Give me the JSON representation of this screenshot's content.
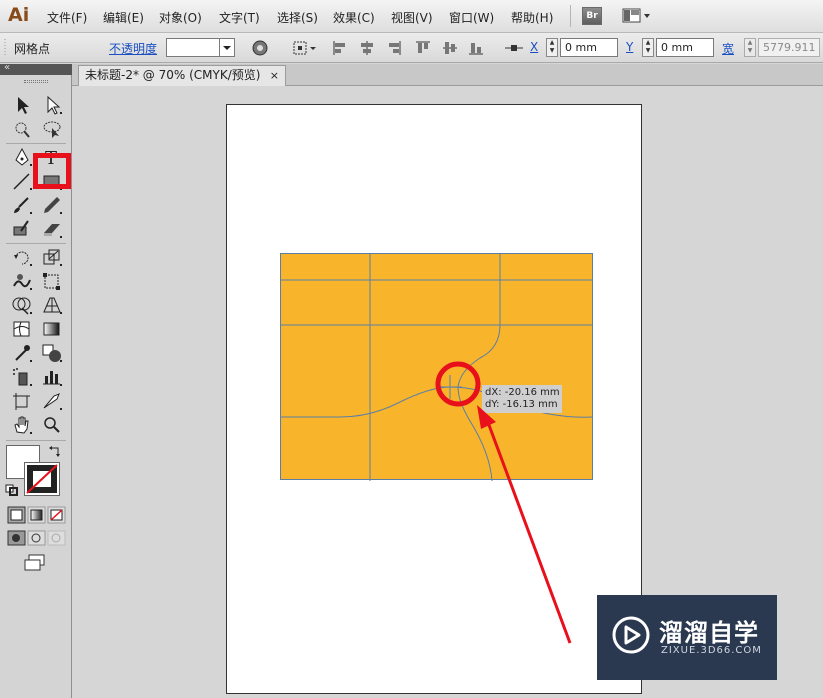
{
  "app": {
    "logo": "Ai"
  },
  "menu": [
    "文件(F)",
    "编辑(E)",
    "对象(O)",
    "文字(T)",
    "选择(S)",
    "效果(C)",
    "视图(V)",
    "窗口(W)",
    "帮助(H)"
  ],
  "menubar_extras": {
    "bridge_label": "Br"
  },
  "control_bar": {
    "selection_label": "网格点",
    "opacity_label": "不透明度",
    "opacity_value": "",
    "x_label": "X",
    "x_value": "0 mm",
    "y_label": "Y",
    "y_value": "0 mm",
    "width_label": "宽",
    "width_value": "5779.911"
  },
  "document_tab": {
    "title": "未标题-2* @ 70% (CMYK/预览)",
    "close": "×"
  },
  "readout": {
    "dx": "dX: -20.16 mm",
    "dy": "dY: -16.13 mm"
  },
  "watermark": {
    "title": "溜溜自学",
    "url": "ZIXUE.3D66.COM"
  },
  "colors": {
    "mesh_fill": "#F8B52B",
    "mesh_lines": "#5a7ea8",
    "highlight_red": "#E8101A",
    "watermark_bg": "#2A3850"
  },
  "tools": {
    "active": "direct-selection-tool",
    "fill_color": "white",
    "stroke_color": "none"
  }
}
